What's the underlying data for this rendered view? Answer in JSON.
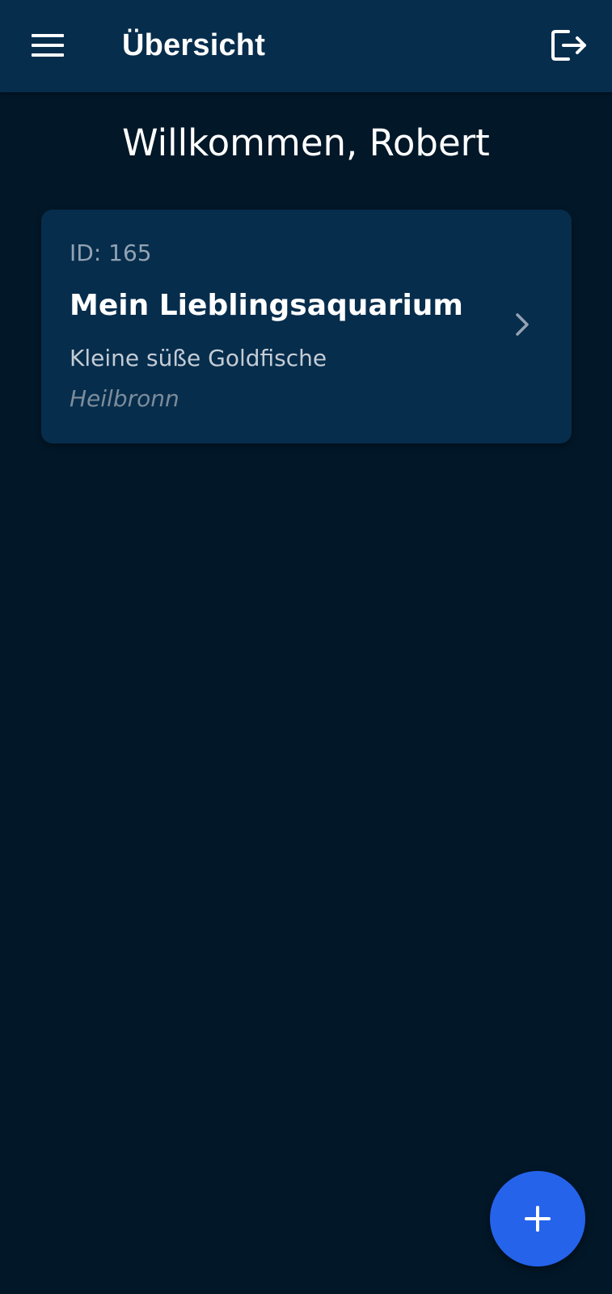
{
  "app_bar": {
    "title": "Übersicht",
    "menu_icon": "hamburger-menu-icon",
    "logout_icon": "logout-icon",
    "background": "#072d4c"
  },
  "welcome": {
    "text": "Willkommen, Robert"
  },
  "aquariums": [
    {
      "id_label": "ID: 165",
      "name": "Mein Lieblingsaquarium",
      "description": "Kleine süße Goldfische",
      "location": "Heilbronn",
      "chevron_icon": "chevron-right-icon"
    }
  ],
  "fab": {
    "icon": "plus-icon",
    "color": "#2563eb"
  },
  "colors": {
    "background": "#021728",
    "card": "#072d4c",
    "accent": "#2563eb"
  }
}
